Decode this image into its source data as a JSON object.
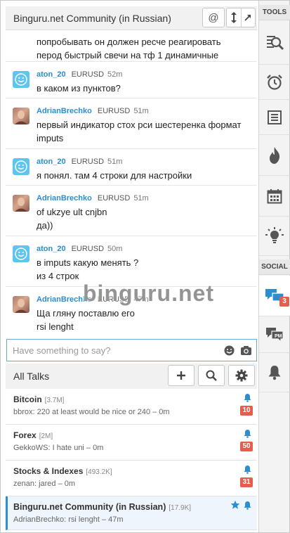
{
  "header": {
    "title": "Binguru.net Community (in Russian)",
    "mention_label": "@"
  },
  "messages": [
    {
      "author": "",
      "symbol": "",
      "time": "",
      "avatar": "",
      "text": "попробывать он должен ресче реагировать\nперод быстрый свечи на тф 1 динамичные"
    },
    {
      "author": "aton_20",
      "symbol": "EURUSD",
      "time": "52m",
      "avatar": "smiley",
      "text": "в каком из пунктов?"
    },
    {
      "author": "AdrianBrechko",
      "symbol": "EURUSD",
      "time": "51m",
      "avatar": "photo",
      "text": "первый индикатор стох рси шестеренка формат\nimputs"
    },
    {
      "author": "aton_20",
      "symbol": "EURUSD",
      "time": "51m",
      "avatar": "smiley",
      "text": "я понял. там 4 строки для настройки"
    },
    {
      "author": "AdrianBrechko",
      "symbol": "EURUSD",
      "time": "51m",
      "avatar": "photo",
      "text": "of ukzye ult cnjbn\nда))"
    },
    {
      "author": "aton_20",
      "symbol": "EURUSD",
      "time": "50m",
      "avatar": "smiley",
      "text": "в imputs какую менять ?\nиз 4 строк"
    },
    {
      "author": "AdrianBrechko",
      "symbol": "EURUSD",
      "time": "47m",
      "avatar": "photo",
      "text": "Ща гляну поставлю его\nrsi lenght"
    }
  ],
  "watermark": "binguru.net",
  "compose": {
    "placeholder": "Have something to say?"
  },
  "talks": {
    "title": "All Talks",
    "items": [
      {
        "name": "Bitcoin",
        "size": "[3.7M]",
        "last": "bbrox: 220 at least would be nice or 240 – 0m",
        "badge": "10",
        "active": false,
        "starred": false
      },
      {
        "name": "Forex",
        "size": "[2M]",
        "last": "GekkoWS: I hate uni – 0m",
        "badge": "50",
        "active": false,
        "starred": false
      },
      {
        "name": "Stocks & Indexes",
        "size": "[493.2K]",
        "last": "zenan: jared – 0m",
        "badge": "31",
        "active": false,
        "starred": false
      },
      {
        "name": "Binguru.net Community (in Russian)",
        "size": "[17.9K]",
        "last": "AdrianBrechko: rsi lenght – 47m",
        "badge": "",
        "active": true,
        "starred": true
      }
    ]
  },
  "rail": {
    "tools_label": "TOOLS",
    "social_label": "SOCIAL",
    "chats_badge": "3"
  },
  "colors": {
    "accent": "#2b8ecf",
    "badge": "#e55e4d",
    "smiley_avatar": "#5fc4ef"
  }
}
